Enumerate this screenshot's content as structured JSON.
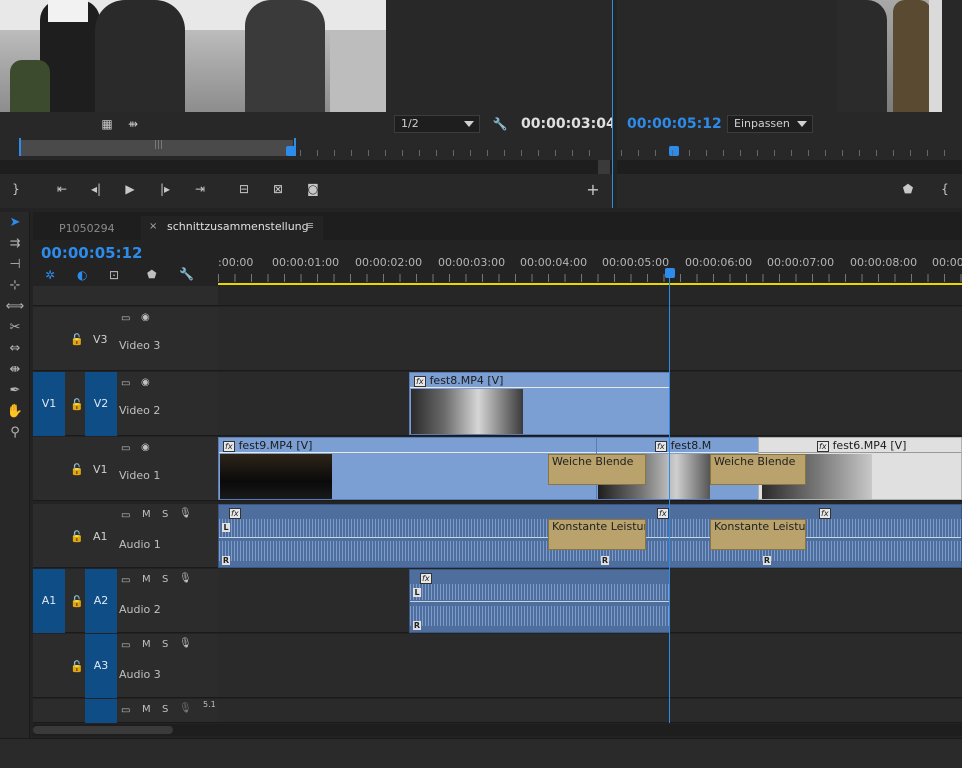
{
  "source_monitor": {
    "resolution": "1/2",
    "timecode": "00:00:03:04"
  },
  "program_monitor": {
    "timecode": "00:00:05:12",
    "zoom": "Einpassen"
  },
  "timeline": {
    "tabs": [
      {
        "label": "P1050294"
      },
      {
        "label": "schnittzusammenstellung"
      }
    ],
    "timecode": "00:00:05:12",
    "ruler": [
      ":00:00",
      "00:00:01:00",
      "00:00:02:00",
      "00:00:03:00",
      "00:00:04:00",
      "00:00:05:00",
      "00:00:06:00",
      "00:00:07:00",
      "00:00:08:00",
      "00:00:0"
    ],
    "tracks": {
      "v3": {
        "label": "V3",
        "name": "Video 3"
      },
      "v2": {
        "label": "V2",
        "name": "Video 2",
        "source": "V1"
      },
      "v1": {
        "label": "V1",
        "name": "Video 1"
      },
      "a1": {
        "label": "A1",
        "name": "Audio 1"
      },
      "a2": {
        "label": "A2",
        "name": "Audio 2",
        "source": "A1"
      },
      "a3": {
        "label": "A3",
        "name": "Audio 3"
      },
      "master": {
        "mix": "5.1"
      }
    },
    "clips": {
      "fest8_v2": "fest8.MP4 [V]",
      "fest9_v1": "fest9.MP4 [V]",
      "fest8_v1": "fest8.M",
      "fest6_v1": "fest6.MP4 [V]",
      "transition_v1_a": "Weiche Blende",
      "transition_v1_b": "Weiche Blende",
      "transition_a1_a": "Konstante Leistung",
      "transition_a1_b": "Konstante Leistung"
    },
    "audio_channels": {
      "left": "L",
      "right": "R"
    },
    "track_toggles": {
      "mute": "M",
      "solo": "S"
    }
  },
  "colors": {
    "accent": "#2d8ceb",
    "video_clip": "#7b9fd3",
    "audio_clip": "#4e6f9e",
    "transition": "#b9a26b",
    "work_area": "#e8d800",
    "target": "#0f4d86"
  }
}
